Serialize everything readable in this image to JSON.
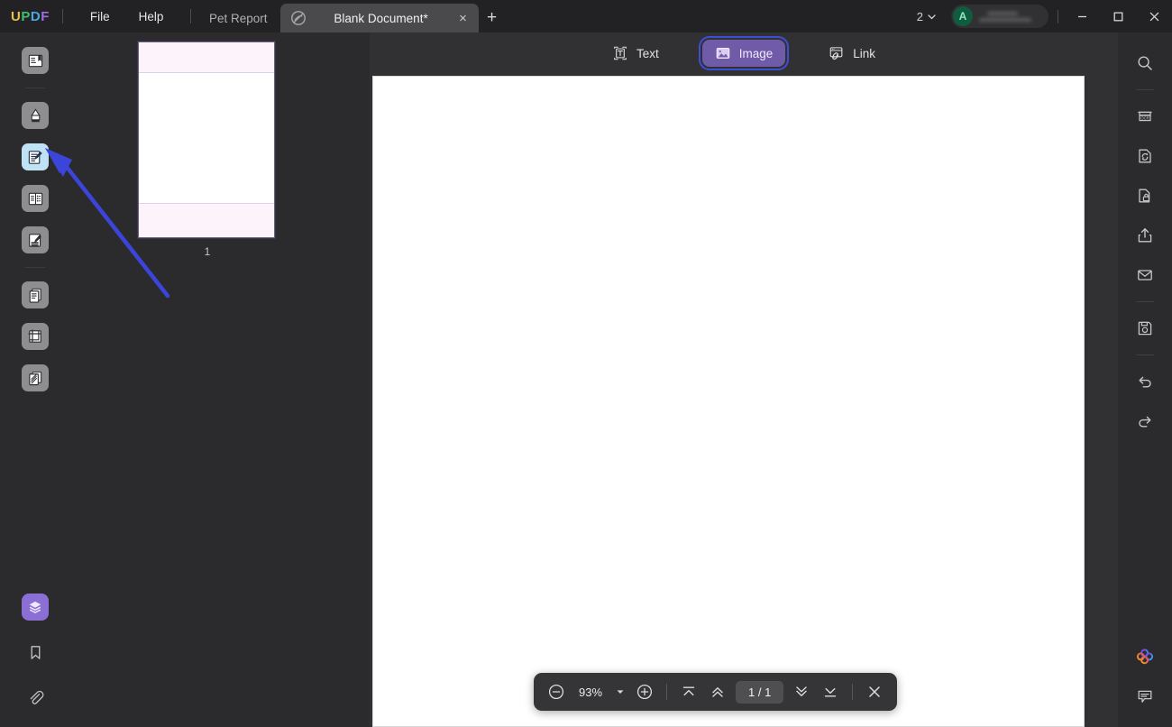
{
  "app": {
    "logo": {
      "l1": "U",
      "l2": "P",
      "l3": "D",
      "l4": "F"
    },
    "menus": [
      {
        "label": "File",
        "name": "menu-file"
      },
      {
        "label": "Help",
        "name": "menu-help"
      }
    ]
  },
  "tabs": {
    "items": [
      {
        "label": "Pet Report",
        "active": false
      },
      {
        "label": "Blank Document*",
        "active": true
      }
    ],
    "close_glyph": "×",
    "new_tab_glyph": "+",
    "count_label": "2"
  },
  "titlebar": {
    "avatar_initial": "A",
    "minimize": "—",
    "maximize": "☐",
    "close": "×"
  },
  "left_rail": {
    "items": [
      {
        "name": "sidebar-reader-icon",
        "label": "Reader"
      },
      {
        "name": "sidebar-annotate-icon",
        "label": "Annotate"
      },
      {
        "name": "sidebar-edit-pdf-icon",
        "label": "Edit PDF"
      },
      {
        "name": "sidebar-page-edit-icon",
        "label": "Page Edit"
      },
      {
        "name": "sidebar-form-icon",
        "label": "Form"
      },
      {
        "name": "sidebar-convert-pdf-icon",
        "label": "Convert PDF"
      },
      {
        "name": "sidebar-crop-icon",
        "label": "Crop"
      },
      {
        "name": "sidebar-batch-icon",
        "label": "Batch"
      }
    ],
    "active_index": 2,
    "bottom": [
      {
        "name": "layers-icon",
        "label": "Layers"
      },
      {
        "name": "bookmark-icon",
        "label": "Bookmark"
      },
      {
        "name": "attachment-icon",
        "label": "Attachment"
      }
    ]
  },
  "thumbnails": {
    "pages": [
      {
        "number": "1"
      }
    ]
  },
  "edit_toolbar": {
    "text_label": "Text",
    "image_label": "Image",
    "link_label": "Link",
    "selected": "Image",
    "selection_outline_color": "#3d4fd6",
    "selection_fill_color": "#6f5ba8"
  },
  "zoom_bar": {
    "zoom_out": "−",
    "zoom_level": "93%",
    "dropdown_caret": "▾",
    "zoom_in": "+",
    "first_page": "first-page",
    "prev_page": "prev-page",
    "page_indicator": "1 / 1",
    "next_page": "next-page",
    "last_page": "last-page",
    "close": "×"
  },
  "right_rail": {
    "items": [
      {
        "name": "search-icon",
        "label": "Search"
      },
      {
        "name": "ocr-icon",
        "label": "OCR"
      },
      {
        "name": "convert-icon",
        "label": "Convert"
      },
      {
        "name": "protect-icon",
        "label": "Protect"
      },
      {
        "name": "share-icon",
        "label": "Share"
      },
      {
        "name": "email-icon",
        "label": "Email"
      },
      {
        "name": "save-icon",
        "label": "Save"
      },
      {
        "name": "undo-icon",
        "label": "Undo"
      },
      {
        "name": "redo-icon",
        "label": "Redo"
      }
    ],
    "bottom": [
      {
        "name": "ai-assistant-icon",
        "label": "AI Assistant"
      },
      {
        "name": "comment-icon",
        "label": "Comment"
      }
    ]
  },
  "annotation": {
    "arrow_color": "#3b45d9",
    "arrow_label": "pointer-arrow"
  },
  "colors": {
    "window_bg": "#2b2b2d",
    "titlebar_bg": "#222224",
    "active_tab_bg": "#4a4a4c",
    "main_bg": "#313133",
    "page_white": "#ffffff",
    "accent_purple": "#8b6fd4",
    "highlight_blue": "#bfe2f5"
  }
}
